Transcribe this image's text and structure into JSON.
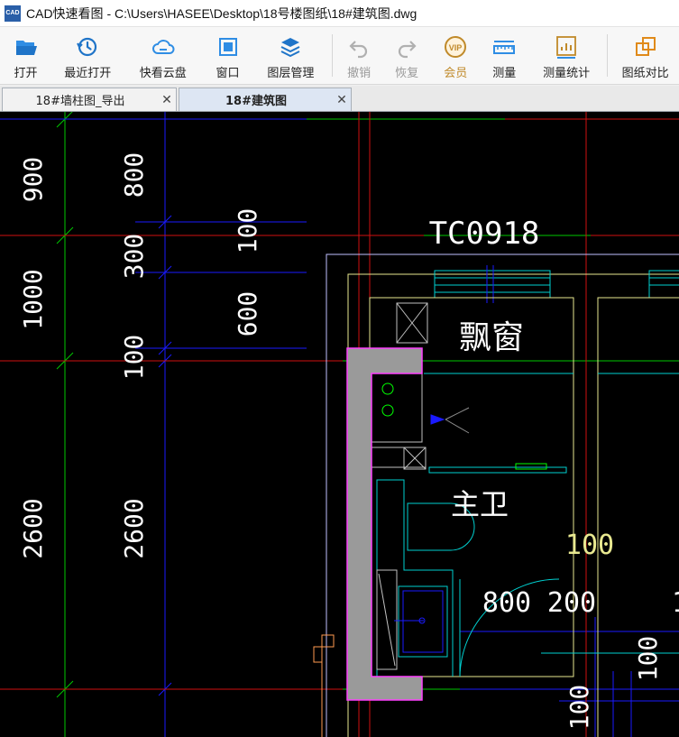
{
  "window": {
    "app_icon_text": "CAD",
    "title": "CAD快速看图 - C:\\Users\\HASEE\\Desktop\\18号楼图纸\\18#建筑图.dwg"
  },
  "toolbar": {
    "open": "打开",
    "recent": "最近打开",
    "cloud": "快看云盘",
    "window": "窗口",
    "layers": "图层管理",
    "undo": "撤销",
    "redo": "恢复",
    "vip": "会员",
    "measure": "测量",
    "measure_stats": "测量统计",
    "compare": "图纸对比"
  },
  "tabs": [
    {
      "label": "18#墙柱图_导出",
      "active": false
    },
    {
      "label": "18#建筑图",
      "active": true
    }
  ],
  "drawing": {
    "dims": {
      "d900": "900",
      "d800": "800",
      "d300": "300",
      "d100a": "100",
      "d1000": "1000",
      "d600": "600",
      "d100b": "100",
      "d2600a": "2600",
      "d2600b": "2600",
      "d100c": "100",
      "d800b": "800",
      "d200": "200",
      "d100d": "100",
      "d100e": "100",
      "d1": "1"
    },
    "labels": {
      "window_code": "TC0918",
      "bay_window": "飘窗",
      "bathroom": "主卫"
    }
  },
  "colors": {
    "canvas_bg": "#000000",
    "axis_green": "#00c800",
    "dim_blue": "#1a1aff",
    "red_line": "#d01010",
    "cyan": "#00d0d0",
    "wall_fill": "#9a9a9a",
    "wall_outline": "#ff40ff",
    "yellow": "#e8e890"
  }
}
